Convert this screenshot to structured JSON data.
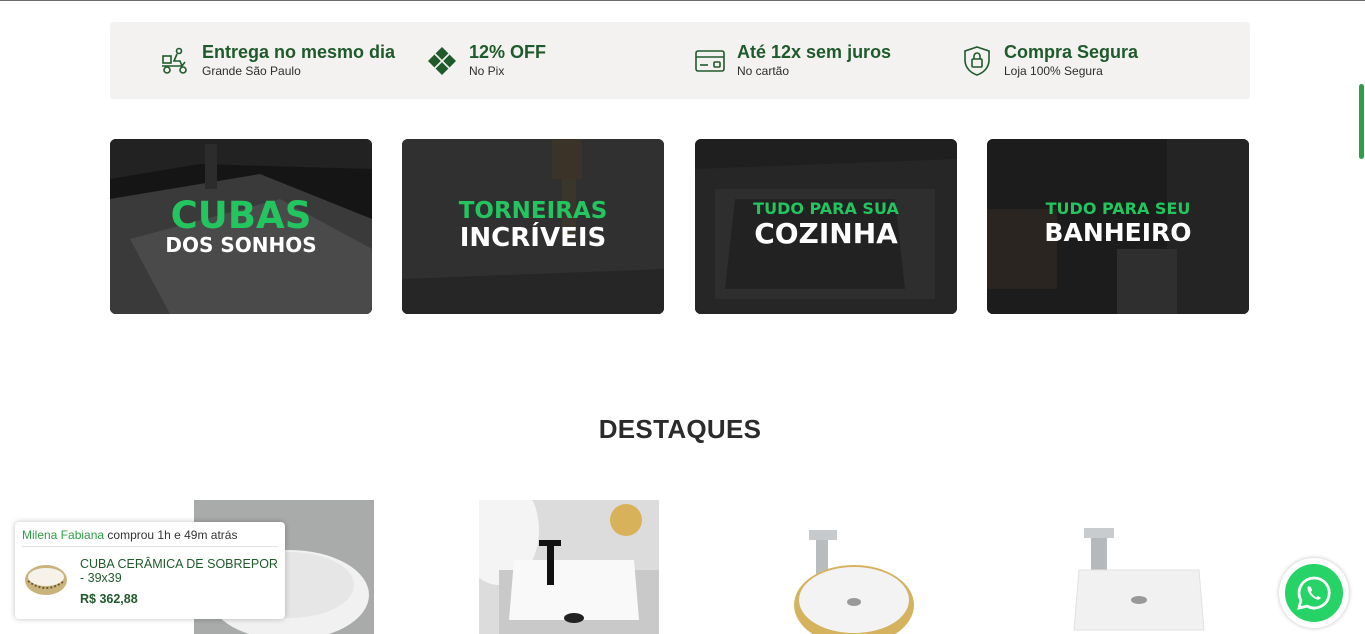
{
  "benefits": [
    {
      "icon": "delivery-scooter-icon",
      "title": "Entrega no mesmo dia",
      "sub": "Grande São Paulo"
    },
    {
      "icon": "pix-icon",
      "title": "12% OFF",
      "sub": "No Pix"
    },
    {
      "icon": "credit-card-icon",
      "title": "Até 12x sem juros",
      "sub": "No cartão"
    },
    {
      "icon": "shield-lock-icon",
      "title": "Compra Segura",
      "sub": "Loja 100% Segura"
    }
  ],
  "banners": [
    {
      "line1": "CUBAS",
      "line2": "DOS SONHOS"
    },
    {
      "line1": "TORNEIRAS",
      "line2": "INCRÍVEIS"
    },
    {
      "line1": "TUDO PARA SUA",
      "line2": "COZINHA"
    },
    {
      "line1": "TUDO PARA SEU",
      "line2": "BANHEIRO"
    }
  ],
  "section": {
    "title": "DESTAQUES"
  },
  "popup": {
    "name": "Milena Fabiana",
    "action": "comprou 1h e 49m atrás",
    "product": "CUBA CERÂMICA DE SOBREPOR - 39x39",
    "price": "R$ 362,88"
  },
  "colors": {
    "brand_green": "#1f5a2b",
    "accent_green": "#22c55e",
    "whatsapp": "#25d366"
  }
}
